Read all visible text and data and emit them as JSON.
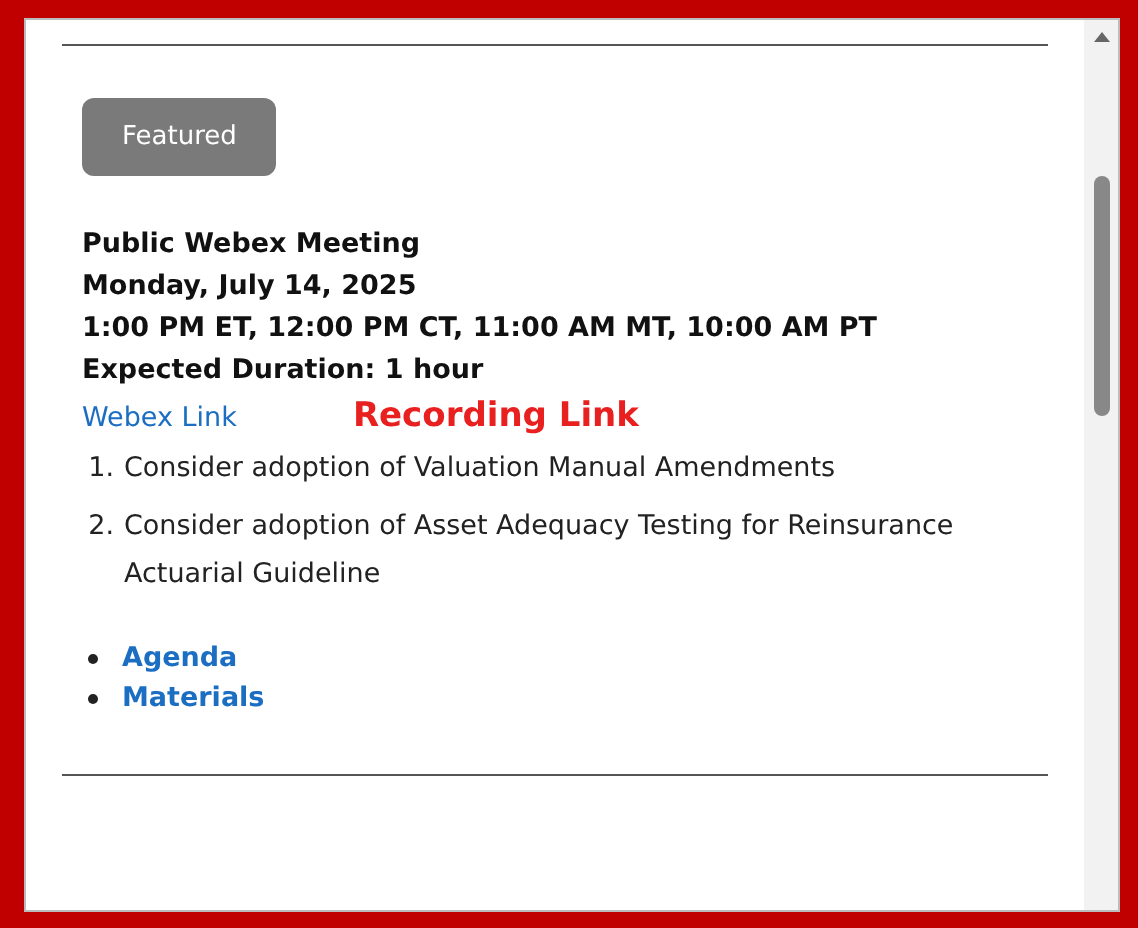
{
  "badge": "Featured",
  "heading_lines": [
    "Public Webex Meeting",
    "Monday, July 14, 2025",
    "1:00 PM ET, 12:00 PM CT, 11:00 AM MT, 10:00 AM PT",
    "Expected Duration: 1 hour"
  ],
  "webex_link": "Webex Link",
  "recording_link": "Recording Link",
  "agenda_items": [
    {
      "number": "1.",
      "text": "Consider adoption of Valuation Manual Amendments"
    },
    {
      "number": "2.",
      "text": "Consider adoption of Asset Adequacy Testing for Reinsurance Actuarial Guideline"
    }
  ],
  "bullet_links": [
    "Agenda",
    "Materials"
  ]
}
